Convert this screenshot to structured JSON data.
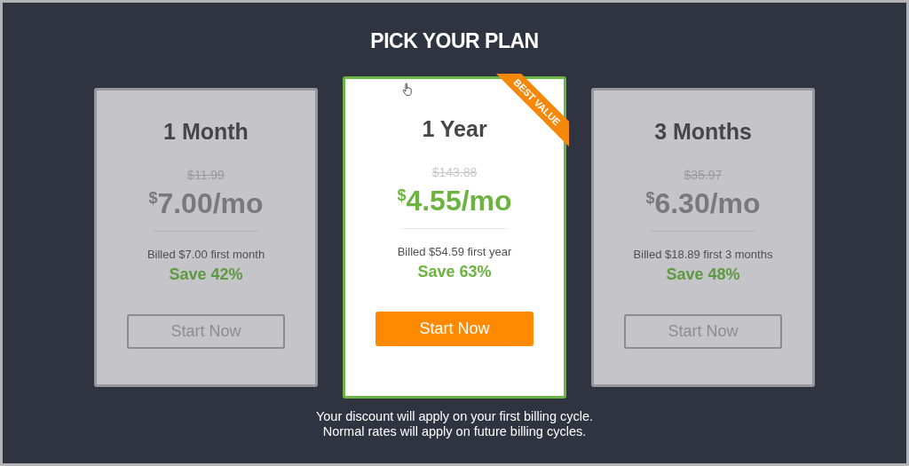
{
  "title": "PICK YOUR PLAN",
  "plans": [
    {
      "name": "1 Month",
      "old_price": "$11.99",
      "currency": "$",
      "amount": "7.00/mo",
      "billed": "Billed $7.00 first month",
      "save": "Save 42%",
      "button": "Start Now",
      "selected": false
    },
    {
      "name": "1 Year",
      "old_price": "$143.88",
      "currency": "$",
      "amount": "4.55/mo",
      "billed": "Billed $54.59 first year",
      "save": "Save 63%",
      "button": "Start Now",
      "selected": true,
      "badge": "BEST VALUE"
    },
    {
      "name": "3 Months",
      "old_price": "$35.97",
      "currency": "$",
      "amount": "6.30/mo",
      "billed": "Billed $18.89 first 3 months",
      "save": "Save 48%",
      "button": "Start Now",
      "selected": false
    }
  ],
  "notes": [
    "Your discount will apply on your first billing cycle.",
    "Normal rates will apply on future billing cycles."
  ]
}
